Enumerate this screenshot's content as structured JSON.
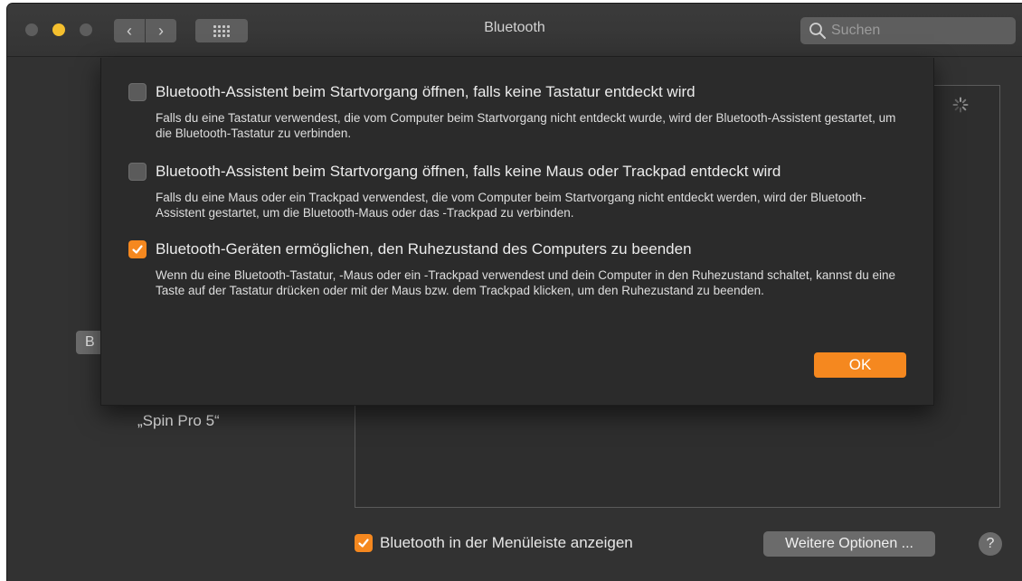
{
  "window": {
    "title": "Bluetooth",
    "search_placeholder": "Suchen",
    "nav_back": "‹",
    "nav_forward": "›"
  },
  "background": {
    "partial_button_label": "B",
    "device_name": "„Spin Pro 5“",
    "show_in_menubar": {
      "label": "Bluetooth in der Menüleiste anzeigen",
      "checked": true
    },
    "more_options_label": "Weitere Optionen ...",
    "help_label": "?"
  },
  "sheet": {
    "options": [
      {
        "label": "Bluetooth-Assistent beim Startvorgang öffnen, falls keine Tastatur entdeckt wird",
        "checked": false,
        "description": "Falls du eine Tastatur verwendest, die vom Computer beim Startvorgang nicht entdeckt wurde, wird der Bluetooth-Assistent gestartet, um die Bluetooth-Tastatur zu verbinden."
      },
      {
        "label": "Bluetooth-Assistent beim Startvorgang öffnen, falls keine Maus oder Trackpad entdeckt wird",
        "checked": false,
        "description": "Falls du eine Maus oder ein Trackpad verwendest, die vom Computer beim Startvorgang nicht entdeckt werden, wird der Bluetooth-Assistent gestartet, um die Bluetooth-Maus oder das -Trackpad zu verbinden."
      },
      {
        "label": "Bluetooth-Geräten ermöglichen, den Ruhezustand des Computers zu beenden",
        "checked": true,
        "description": "Wenn du eine Bluetooth-Tastatur, -Maus oder ein -Trackpad verwendest und dein Computer in den Ruhezustand schaltet, kannst du eine Taste auf der Tastatur drücken oder mit der Maus bzw. dem Trackpad klicken, um den Ruhezustand zu beenden."
      }
    ],
    "ok_label": "OK"
  },
  "colors": {
    "accent": "#f5881f",
    "window_bg": "#323232",
    "sheet_bg": "#2b2b2b"
  }
}
